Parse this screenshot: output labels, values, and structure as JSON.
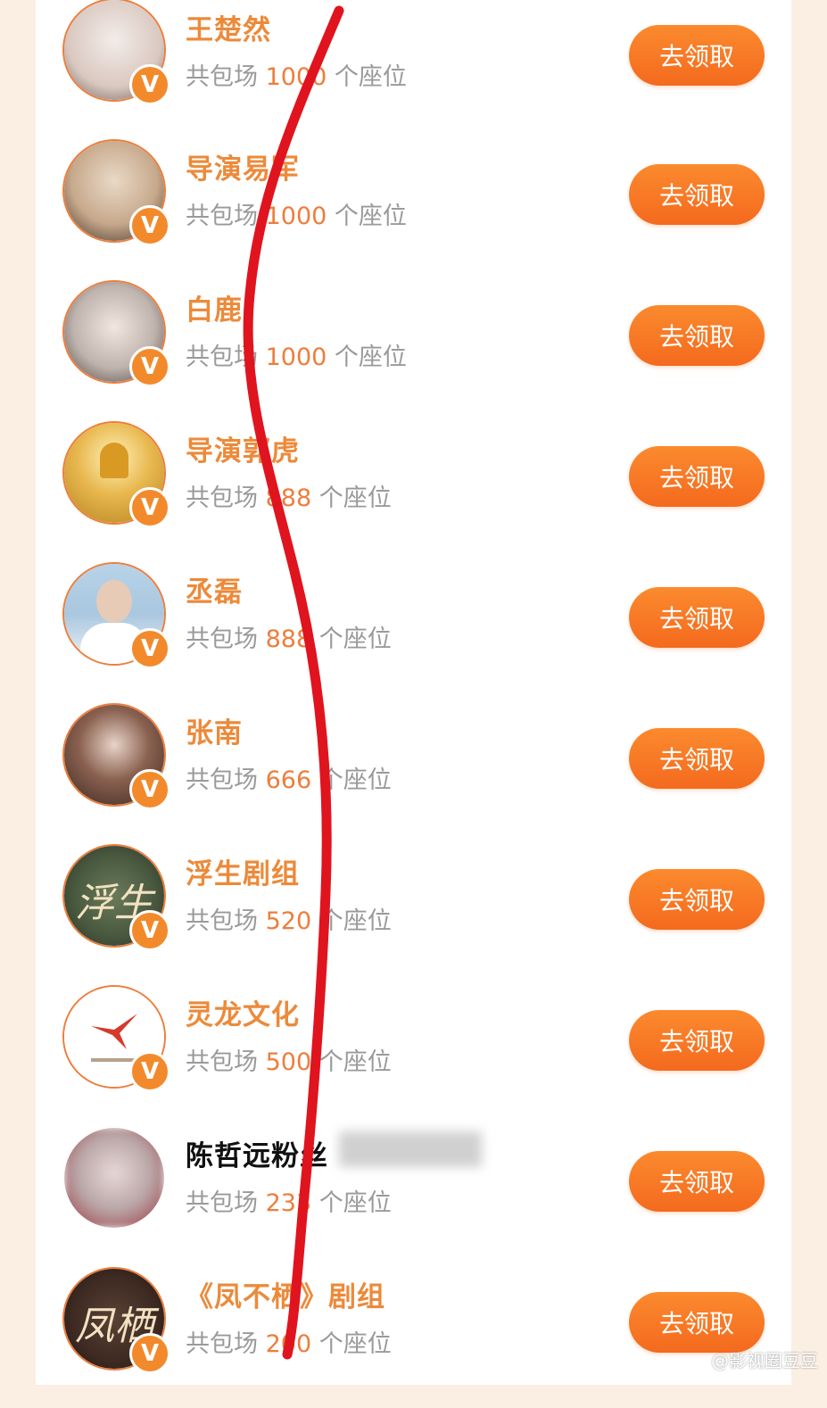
{
  "list": {
    "items": [
      {
        "name": "王楚然",
        "prefix": "共包场",
        "count": "1000",
        "suffix": "个座位",
        "button": "去领取",
        "avatar": "person-photo",
        "avatar_color": "#d9c8c0"
      },
      {
        "name": "导演易军",
        "prefix": "共包场",
        "count": "1000",
        "suffix": "个座位",
        "button": "去领取",
        "avatar": "person-photo",
        "avatar_color": "#c7a98c"
      },
      {
        "name": "白鹿",
        "prefix": "共包场",
        "count": "1000",
        "suffix": "个座位",
        "button": "去领取",
        "avatar": "person-photo",
        "avatar_color": "#bfb3ad"
      },
      {
        "name": "导演郭虎",
        "prefix": "共包场",
        "count": "888",
        "suffix": "个座位",
        "button": "去领取",
        "avatar": "bell-image",
        "avatar_color": "#e8b84f"
      },
      {
        "name": "丞磊",
        "prefix": "共包场",
        "count": "888",
        "suffix": "个座位",
        "button": "去领取",
        "avatar": "person-photo",
        "avatar_color": "#a9c7df"
      },
      {
        "name": "张南",
        "prefix": "共包场",
        "count": "666",
        "suffix": "个座位",
        "button": "去领取",
        "avatar": "person-photo",
        "avatar_color": "#6b4a3b"
      },
      {
        "name": "浮生剧组",
        "prefix": "共包场",
        "count": "520",
        "suffix": "个座位",
        "button": "去领取",
        "avatar": "calligraphy-logo",
        "avatar_color": "#4a5a40",
        "avatar_text": "浮生"
      },
      {
        "name": "灵龙文化",
        "prefix": "共包场",
        "count": "500",
        "suffix": "个座位",
        "button": "去领取",
        "avatar": "bird-logo",
        "avatar_color": "#ffffff"
      },
      {
        "name": "陈哲远粉丝",
        "prefix": "共包场",
        "count": "233",
        "suffix": "个座位",
        "button": "去领取",
        "avatar": "blurred-photo",
        "avatar_color": "#b9a6a6",
        "dark": true
      },
      {
        "name": "《凤不栖》剧组",
        "prefix": "共包场",
        "count": "200",
        "suffix": "个座位",
        "button": "去领取",
        "avatar": "calligraphy-logo",
        "avatar_color": "#3d2a22",
        "avatar_text": "凤栖"
      }
    ]
  },
  "watermark": "@影视圈豆豆",
  "colors": {
    "accent": "#ee7d3b",
    "button": "#f46a1e",
    "annotation": "#e0141e"
  }
}
